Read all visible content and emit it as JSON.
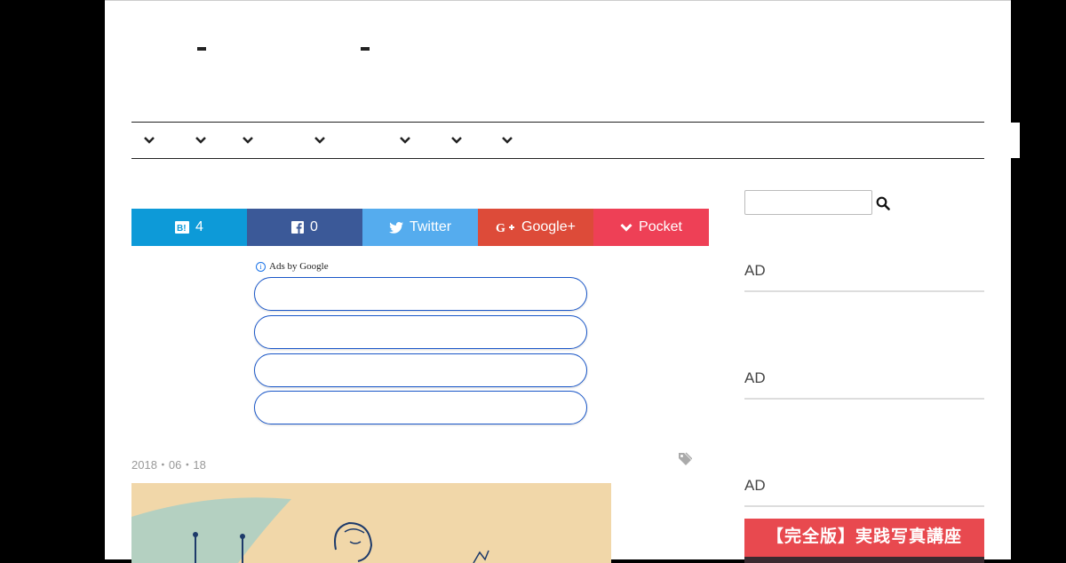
{
  "site": {
    "title_dashes": [
      "-",
      "-"
    ]
  },
  "nav": {
    "dropdown_count": 7
  },
  "share": {
    "hatena_count": "4",
    "facebook_count": "0",
    "twitter_label": "Twitter",
    "google_label": "Google+",
    "pocket_label": "Pocket",
    "colors": {
      "hatena": "#0d9ad8",
      "facebook": "#3b5998",
      "twitter": "#55acee",
      "google": "#dd4b39",
      "pocket": "#ee4056"
    }
  },
  "ads": {
    "label": "Ads by Google",
    "info_glyph": "i",
    "pill_count": 4
  },
  "post": {
    "date": "2018・06・18"
  },
  "sidebar": {
    "search": {
      "placeholder": ""
    },
    "widgets": [
      "AD",
      "AD",
      "AD"
    ],
    "promo_title": "【完全版】実践写真講座",
    "promo_color": "#e8494f"
  }
}
